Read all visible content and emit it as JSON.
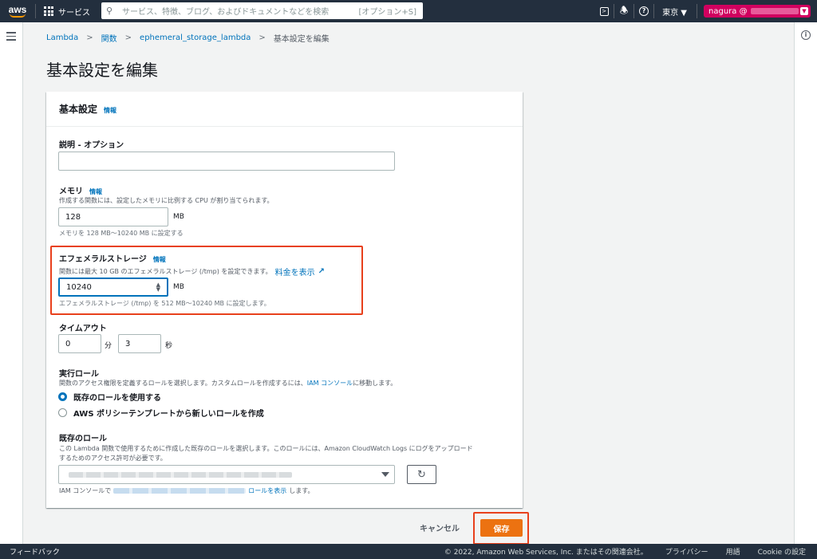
{
  "nav": {
    "logo": "aws",
    "services": "サービス",
    "search_placeholder": "サービス、特徴、ブログ、およびドキュメントなどを検索",
    "search_shortcut": "[オプション+S]",
    "region": "東京 ▼",
    "account": "nagura @",
    "accent": "#ff9900"
  },
  "breadcrumb": {
    "items": [
      "Lambda",
      "関数",
      "ephemeral_storage_lambda"
    ],
    "current": "基本設定を編集"
  },
  "page_title": "基本設定を編集",
  "panel": {
    "title": "基本設定",
    "info": "情報",
    "description": {
      "label": "説明 - オプション",
      "value": ""
    },
    "memory": {
      "label": "メモリ",
      "info": "情報",
      "desc": "作成する関数には、設定したメモリに比例する CPU が割り当てられます。",
      "value": "128",
      "unit": "MB",
      "constraint": "メモリを 128 MB〜10240 MB に設定する"
    },
    "ephemeral": {
      "label": "エフェメラルストレージ",
      "info": "情報",
      "desc": "関数には最大 10 GB のエフェメラルストレージ (/tmp) を設定できます。",
      "pricing_link": "料金を表示",
      "value": "10240",
      "unit": "MB",
      "constraint": "エフェメラルストレージ (/tmp) を 512 MB〜10240 MB に設定します。"
    },
    "timeout": {
      "label": "タイムアウト",
      "minutes": "0",
      "min_unit": "分",
      "seconds": "3",
      "sec_unit": "秒"
    },
    "role": {
      "label": "実行ロール",
      "desc_before": "関数のアクセス権限を定義するロールを選択します。カスタムロールを作成するには、",
      "iam_link": "IAM コンソール",
      "desc_after": "に移動します。",
      "option_existing": "既存のロールを使用する",
      "option_template": "AWS ポリシーテンプレートから新しいロールを作成"
    },
    "existing_role": {
      "label": "既存のロール",
      "desc1": "この Lambda 関数で使用するために作成した既存のロールを選択します。このロールには、Amazon CloudWatch Logs にログをアップロード",
      "desc2": "するためのアクセス許可が必要です。",
      "footer_before": "IAM コンソールで",
      "footer_link": "ロールを表示",
      "footer_after": "します。"
    }
  },
  "actions": {
    "cancel": "キャンセル",
    "save": "保存"
  },
  "footer": {
    "feedback": "フィードバック",
    "copyright": "© 2022, Amazon Web Services, Inc. またはその関連会社。",
    "privacy": "プライバシー",
    "terms": "用語",
    "cookie": "Cookie の設定"
  }
}
